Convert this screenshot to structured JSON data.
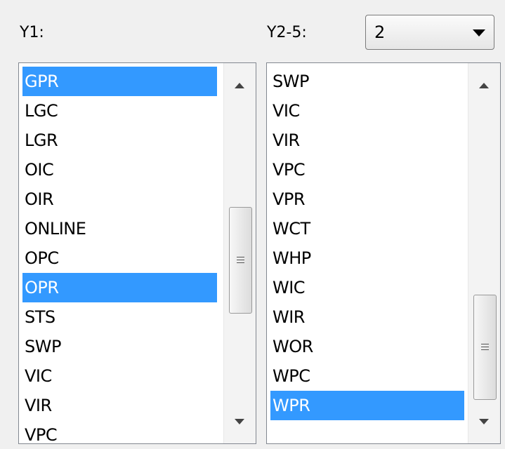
{
  "y1": {
    "label": "Y1:",
    "items": [
      "GPR",
      "LGC",
      "LGR",
      "OIC",
      "OIR",
      "ONLINE",
      "OPC",
      "OPR",
      "STS",
      "SWP",
      "VIC",
      "VIR",
      "VPC"
    ],
    "selected": [
      "GPR",
      "OPR"
    ]
  },
  "y2_5": {
    "label": "Y2-5:",
    "dropdown": {
      "value": "2",
      "icon": "chevron-down-icon"
    },
    "items": [
      "SWP",
      "VIC",
      "VIR",
      "VPC",
      "VPR",
      "WCT",
      "WHP",
      "WIC",
      "WIR",
      "WOR",
      "WPC",
      "WPR"
    ],
    "selected": [
      "WPR"
    ]
  },
  "colors": {
    "selection": "#3399ff",
    "window": "#f0f0f0"
  }
}
